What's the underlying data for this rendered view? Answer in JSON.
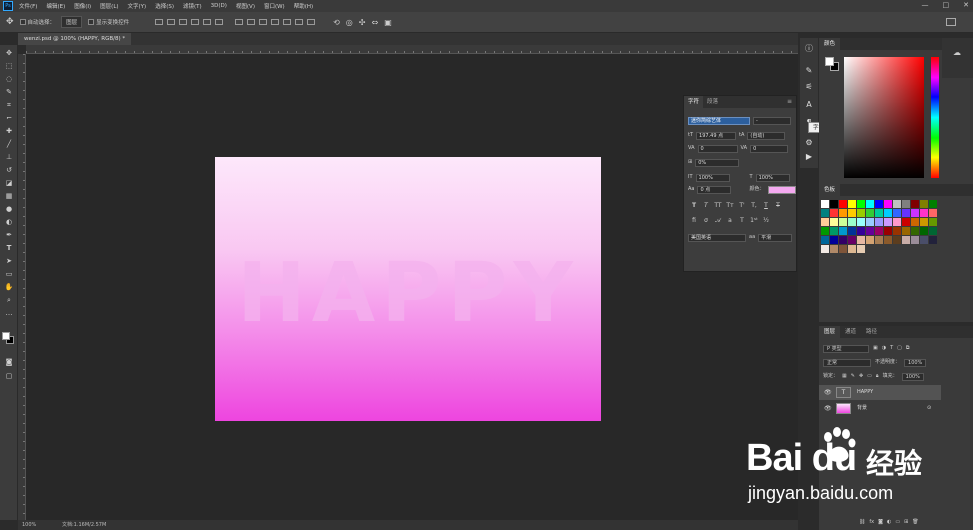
{
  "menubar": {
    "items": [
      "文件(F)",
      "编辑(E)",
      "图像(I)",
      "图层(L)",
      "文字(Y)",
      "选择(S)",
      "滤镜(T)",
      "3D(D)",
      "视图(V)",
      "窗口(W)",
      "帮助(H)"
    ],
    "window_controls": [
      "—",
      "□",
      "✕"
    ]
  },
  "options": {
    "auto_select_label": "自动选择：",
    "auto_select_value": "图层",
    "transform_label": "显示变换控件"
  },
  "document": {
    "tab_label": "wenzi.psd @ 100% (HAPPY, RGB/8) *",
    "canvas_text": "HAPPY"
  },
  "status": {
    "zoom": "100%",
    "doc_info": "文档:1.16M/2.57M"
  },
  "character_panel": {
    "tabs": [
      "字符",
      "段落"
    ],
    "font_family": "迷你简综艺体",
    "font_style": "-",
    "font_size": "197.49 点",
    "leading": "(自动)",
    "kerning": "0",
    "tracking": "0",
    "scale_pct": "0%",
    "vscale": "100%",
    "hscale": "100%",
    "baseline": "0 点",
    "color_label": "颜色：",
    "text_color": "#f4a9f0",
    "style_buttons": [
      "T",
      "T",
      "TT",
      "Tт",
      "T'",
      "T,",
      "T",
      "T"
    ],
    "anti_alias": "美国英语",
    "aa_method": "平滑"
  },
  "tooltip": "字符",
  "color_panel": {
    "tab": "颜色"
  },
  "swatch_panel": {
    "tab": "色板"
  },
  "layers_panel": {
    "tabs": [
      "图层",
      "通道",
      "路径"
    ],
    "filter_kind": "P 类型",
    "blend_mode": "正常",
    "opacity_label": "不透明度：",
    "opacity": "100%",
    "lock_label": "锁定：",
    "fill_label": "填充：",
    "fill": "100%",
    "layers": [
      {
        "name": "HAPPY",
        "type": "text"
      },
      {
        "name": "背景",
        "type": "image"
      }
    ]
  },
  "watermark": {
    "brand": "Bai du",
    "jingyan": "经验",
    "url": "jingyan.baidu.com"
  }
}
